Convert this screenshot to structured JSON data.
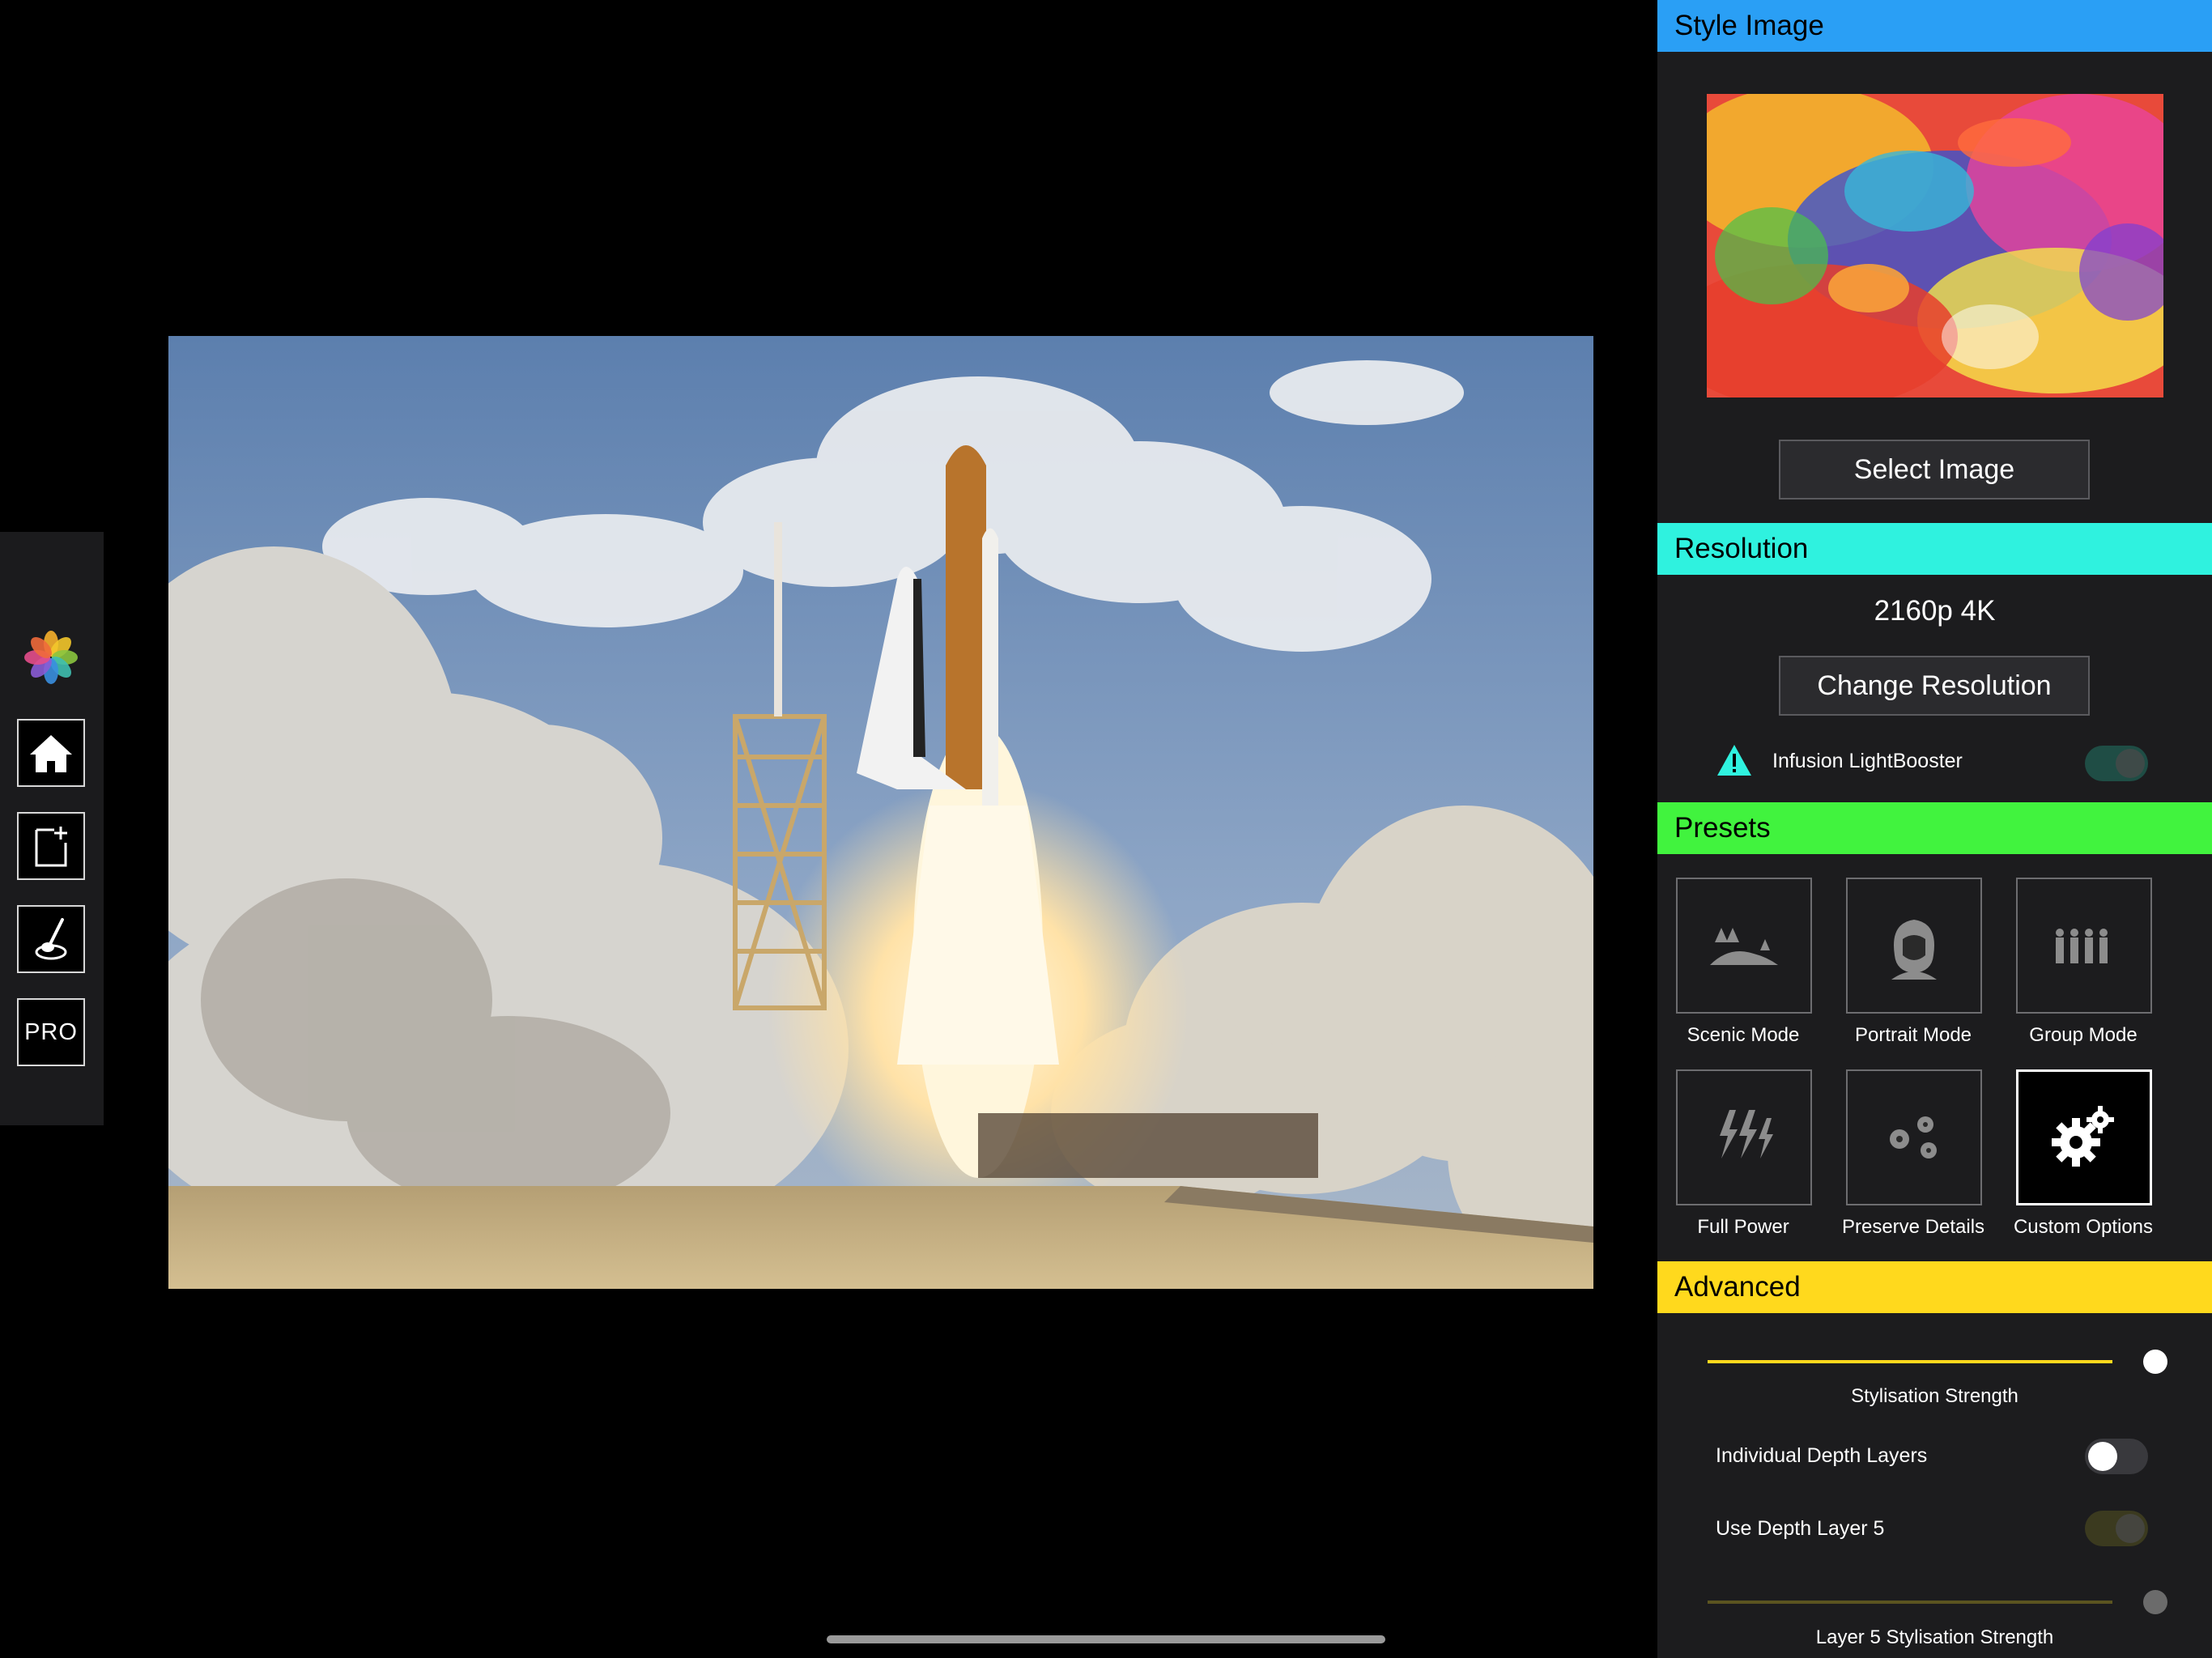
{
  "toolbar": {
    "items": [
      {
        "name": "photos-icon"
      },
      {
        "name": "home-icon"
      },
      {
        "name": "new-document-icon"
      },
      {
        "name": "brush-icon"
      },
      {
        "name": "pro",
        "label": "PRO"
      }
    ]
  },
  "panel": {
    "style_image": {
      "header": "Style Image",
      "select_button": "Select Image",
      "header_color": "#2a9ff5"
    },
    "resolution": {
      "header": "Resolution",
      "value": "2160p 4K",
      "change_button": "Change Resolution",
      "lightbooster_label": "Infusion LightBooster",
      "lightbooster_on": true,
      "header_color": "#2ff2df"
    },
    "presets": {
      "header": "Presets",
      "header_color": "#41f33e",
      "items": [
        {
          "label": "Scenic Mode",
          "icon": "scenic-icon"
        },
        {
          "label": "Portrait Mode",
          "icon": "portrait-icon"
        },
        {
          "label": "Group Mode",
          "icon": "group-icon"
        },
        {
          "label": "Full Power",
          "icon": "lightning-icon"
        },
        {
          "label": "Preserve Details",
          "icon": "flowers-icon"
        },
        {
          "label": "Custom Options",
          "icon": "gears-icon",
          "selected": true
        }
      ]
    },
    "advanced": {
      "header": "Advanced",
      "header_color": "#ffd91d",
      "stylisation_strength_label": "Stylisation Strength",
      "stylisation_strength_value": 1.0,
      "individual_depth_layers_label": "Individual Depth Layers",
      "individual_depth_layers_on": false,
      "use_depth_layer_5_label": "Use Depth Layer 5",
      "use_depth_layer_5_on": true,
      "layer5_strength_label": "Layer 5 Stylisation Strength",
      "layer5_strength_value": 1.0
    }
  }
}
